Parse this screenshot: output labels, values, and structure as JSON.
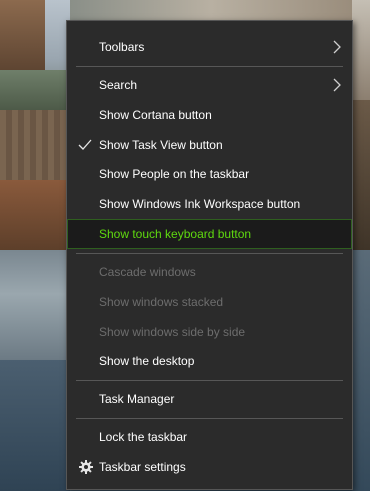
{
  "menu": {
    "toolbars": "Toolbars",
    "search": "Search",
    "show_cortana": "Show Cortana button",
    "show_task_view": "Show Task View button",
    "show_people": "Show People on the taskbar",
    "show_ink": "Show Windows Ink Workspace button",
    "show_touch_keyboard": "Show touch keyboard button",
    "cascade": "Cascade windows",
    "stacked": "Show windows stacked",
    "side_by_side": "Show windows side by side",
    "show_desktop": "Show the desktop",
    "task_manager": "Task Manager",
    "lock_taskbar": "Lock the taskbar",
    "taskbar_settings": "Taskbar settings"
  },
  "colors": {
    "menu_bg": "#2b2b2b",
    "highlight_text": "#5fd90f",
    "disabled_text": "#6d6d6d"
  }
}
